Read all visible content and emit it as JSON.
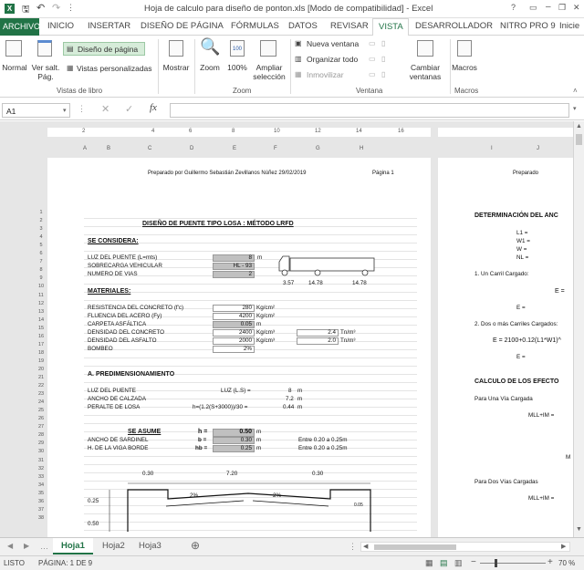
{
  "title": "Hoja de calculo para diseño de ponton.xls [Modo de compatibilidad] - Excel",
  "window_controls": {
    "help": "?",
    "minimize": "–",
    "restore": "❐",
    "close": "✕"
  },
  "tabs": [
    "ARCHIVO",
    "INICIO",
    "INSERTAR",
    "DISEÑO DE PÁGINA",
    "FÓRMULAS",
    "DATOS",
    "REVISAR",
    "VISTA",
    "DESARROLLADOR",
    "NITRO PRO 9",
    "Inicie"
  ],
  "ribbon": {
    "g1": {
      "normal": "Normal",
      "salto": "Ver salt. Pág.",
      "diseno": "Diseño de página",
      "personalizadas": "Vistas personalizadas",
      "label": "Vistas de libro"
    },
    "g2": {
      "mostrar": "Mostrar",
      "label": ""
    },
    "g3": {
      "zoom": "Zoom",
      "p100": "100%",
      "ampliar": "Ampliar selección",
      "label": "Zoom"
    },
    "g4": {
      "nueva": "Nueva ventana",
      "organizar": "Organizar todo",
      "inmovilizar": "Inmovilizar",
      "cambiar": "Cambiar ventanas",
      "label": "Ventana"
    },
    "g5": {
      "macros": "Macros",
      "label": "Macros"
    }
  },
  "namebox": "A1",
  "fx": "fx",
  "col_letters": [
    "A",
    "B",
    "C",
    "D",
    "E",
    "F",
    "G",
    "H",
    "I",
    "J"
  ],
  "ruler_numbers": [
    "1",
    "2",
    "4",
    "6",
    "8",
    "10",
    "12",
    "14",
    "16",
    "18"
  ],
  "rows": [
    "1",
    "2",
    "3",
    "4",
    "5",
    "6",
    "7",
    "8",
    "9",
    "10",
    "11",
    "12",
    "13",
    "14",
    "15",
    "16",
    "17",
    "18",
    "19",
    "20",
    "21",
    "22",
    "23",
    "24",
    "25",
    "26",
    "27",
    "28",
    "29",
    "30",
    "31",
    "32",
    "33",
    "34",
    "35",
    "36",
    "37",
    "38"
  ],
  "page1": {
    "header": "Preparado por Guillermo Sebastián Zevillanos Núñez 29/02/2019",
    "pagenum": "Página 1",
    "title": "DISEÑO DE PUENTE TIPO LOSA : MÉTODO LRFD",
    "se_considera": "SE CONSIDERA:",
    "luz": "LUZ DEL PUENTE (L=mts)",
    "luz_v": "8",
    "luz_u": "m",
    "sobrecarga": "SOBRECARGA VEHICULAR",
    "sobrecarga_v": "HL - 93",
    "vias": "NUMERO DE VIAS",
    "vias_v": "2",
    "truck_d1": "3.57",
    "truck_d2": "14.78",
    "truck_d3": "14.78",
    "materiales": "MATERIALES:",
    "fc": "RESISTENCIA DEL CONCRETO (f'c)",
    "fc_v": "280",
    "fc_u": "Kg/cm²",
    "fy": "FLUENCIA DEL ACERO (Fy)",
    "fy_v": "4200",
    "fy_u": "Kg/cm²",
    "carpeta": "CARPETA ASFÁLTICA",
    "carpeta_v": "0.05",
    "carpeta_u": "m",
    "dc": "DENSIDAD DEL CONCRETO",
    "dc_v": "2400",
    "dc_u": "Kg/cm³",
    "dc_v2": "2.4",
    "dc_u2": "Tn/m³",
    "da": "DENSIDAD DEL ASFALTO",
    "da_v": "2000",
    "da_u": "Kg/cm³",
    "da_v2": "2.0",
    "da_u2": "Tn/m³",
    "bombeo": "BOMBEO",
    "bombeo_v": "2%",
    "predim": "A. PREDIMENSIONAMIENTO",
    "luzp": "LUZ DEL PUENTE",
    "luzp_f": "LUZ (L.S) =",
    "luzp_v": "8",
    "luzp_u": "m",
    "ancho": "ANCHO DE CALZADA",
    "ancho_v": "7.2",
    "ancho_u": "m",
    "peralte": "PERALTE DE LOSA",
    "peralte_f": "h=(1.2(S+3000))/30 =",
    "peralte_v": "0.44",
    "peralte_u": "m",
    "asume": "SE ASUME",
    "h_l": "h =",
    "h_v": "0.50",
    "h_u": "m",
    "sard": "ANCHO DE SARDINEL",
    "b_l": "b =",
    "b_v": "0.30",
    "b_u": "m",
    "b_note": "Entre 0.20 a 0.25m",
    "viga": "H. DE LA VIGA BORDE",
    "hb_l": "hb =",
    "hb_v": "0.25",
    "hb_u": "m",
    "hb_note": "Entre 0.20 a 0.25m",
    "d1": "0.30",
    "d2": "7.20",
    "d3": "0.30",
    "d4": "0.25",
    "d5": "0.50",
    "slope": "2%",
    "slope2": "2%",
    "small": "0.05"
  },
  "page2": {
    "header": "Preparado",
    "det": "DETERMINACIÓN DEL ANC",
    "l1": "L1 =",
    "w1": "W1 =",
    "w": "W =",
    "nl": "NL =",
    "camion": "1. Un Carril Cargado:",
    "e1": "E =",
    "e2": "E =",
    "dos": "2. Dos o más Carriles Cargados:",
    "formula": "E = 2100+0.12(L1*W1)^",
    "e3": "E =",
    "calculo": "CALCULO DE LOS EFECTO",
    "una": "Para Una Vía Cargada",
    "mll": "MLL+IM =",
    "m": "M",
    "dosv": "Para Dos Vías Cargadas",
    "mll2": "MLL+IM ="
  },
  "sheets": [
    "Hoja1",
    "Hoja2",
    "Hoja3"
  ],
  "status": {
    "ready": "LISTO",
    "page": "PÁGINA: 1 DE 9",
    "zoom": "70 %"
  }
}
